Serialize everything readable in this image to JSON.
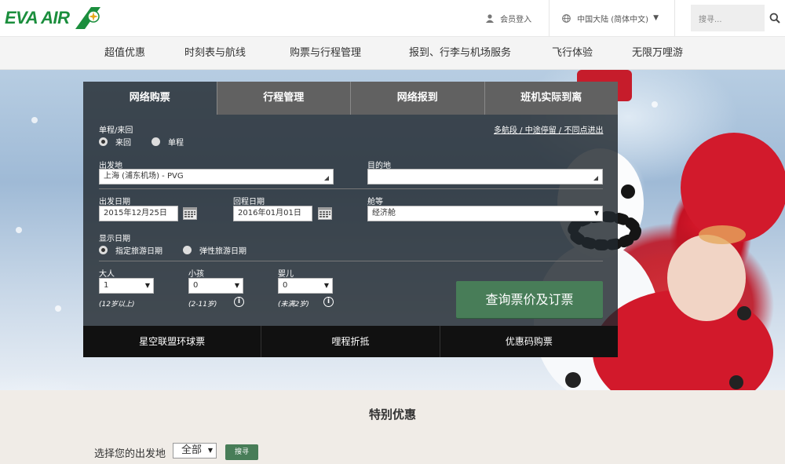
{
  "header": {
    "logo_text": "EVA AIR",
    "login_label": "会员登入",
    "language_label": "中国大陆 (简体中文)",
    "search_placeholder": "搜寻...",
    "brand_color": "#1b8e3d"
  },
  "nav": {
    "items": [
      "超值优惠",
      "时刻表与航线",
      "购票与行程管理",
      "报到、行李与机场服务",
      "飞行体验",
      "无限万哩游"
    ]
  },
  "booking": {
    "tabs": [
      "网络购票",
      "行程管理",
      "网络报到",
      "班机实际到离"
    ],
    "active_tab": 0,
    "trip_type_label": "单程/来回",
    "trip_options": [
      "来回",
      "单程"
    ],
    "multi_link": "多航段 / 中途停留 / 不同点进出",
    "from_label": "出发地",
    "from_value": "上海 (浦东机场) - PVG",
    "to_label": "目的地",
    "to_value": "",
    "depart_label": "出发日期",
    "depart_value": "2015年12月25日",
    "return_label": "回程日期",
    "return_value": "2016年01月01日",
    "cabin_label": "舱等",
    "cabin_value": "经济舱",
    "display_date_label": "显示日期",
    "date_options": [
      "指定旅游日期",
      "弹性旅游日期"
    ],
    "adult_label": "大人",
    "adult_value": "1",
    "adult_note": "(12岁以上)",
    "child_label": "小孩",
    "child_value": "0",
    "child_note": "(2-11岁)",
    "infant_label": "婴儿",
    "infant_value": "0",
    "infant_note": "(未满2岁)",
    "submit_label": "查询票价及订票",
    "submit_color": "#487d58",
    "bottom_tabs": [
      "星空联盟环球票",
      "哩程折抵",
      "优惠码购票"
    ]
  },
  "offers": {
    "title": "特别优惠",
    "origin_label": "选择您的出发地",
    "origin_value": "全部",
    "search_button": "搜寻"
  }
}
